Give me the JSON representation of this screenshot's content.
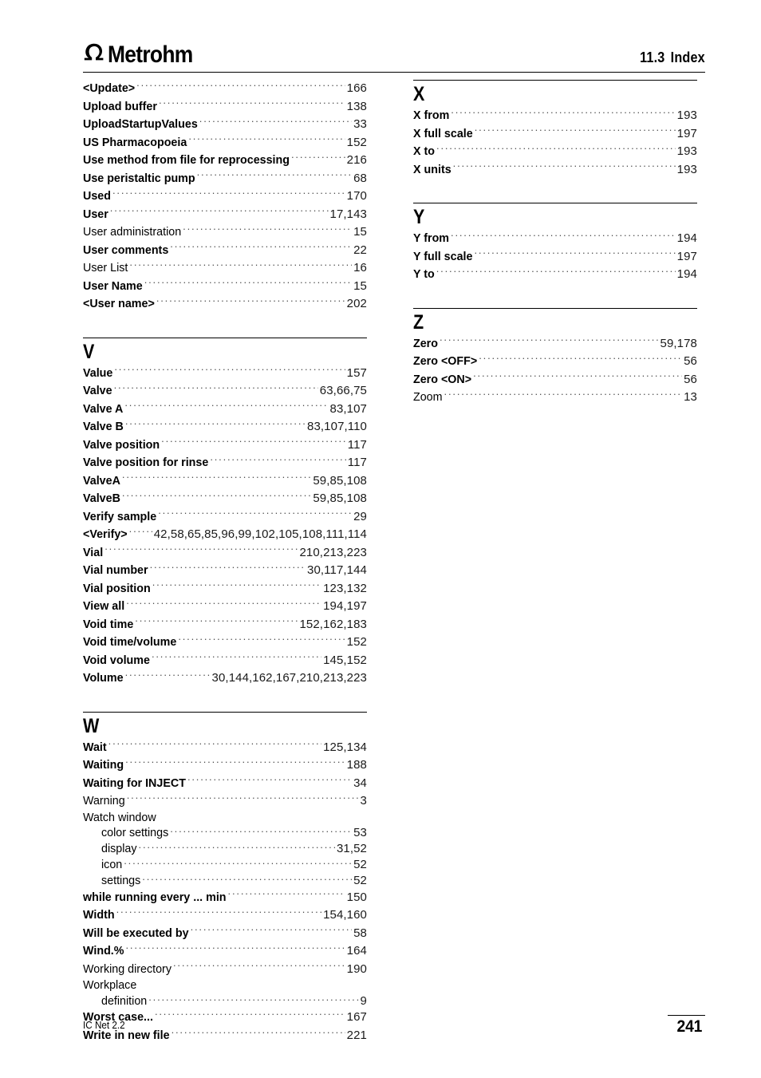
{
  "header": {
    "logo_text": "Metrohm",
    "logo_mark": "omega-icon",
    "section_number": "11.3",
    "section_title": "Index"
  },
  "footer": {
    "product": "IC Net 2.2",
    "page_number": "241"
  },
  "columns": {
    "left": [
      {
        "id": "u-continued",
        "letter": null,
        "rule": false,
        "entries": [
          {
            "label": "<Update>",
            "pages": "166",
            "bold": true
          },
          {
            "label": "Upload buffer",
            "pages": "138",
            "bold": true
          },
          {
            "label": "UploadStartupValues",
            "pages": "33",
            "bold": true
          },
          {
            "label": "US Pharmacopoeia",
            "pages": "152",
            "bold": true
          },
          {
            "label": "Use method from file for reprocessing",
            "pages": "216",
            "bold": true
          },
          {
            "label": "Use peristaltic pump",
            "pages": "68",
            "bold": true
          },
          {
            "label": "Used",
            "pages": "170",
            "bold": true
          },
          {
            "label": "User",
            "pages": "17,143",
            "bold": true
          },
          {
            "label": "User administration",
            "pages": "15",
            "bold": false
          },
          {
            "label": "User comments",
            "pages": "22",
            "bold": true
          },
          {
            "label": "User List",
            "pages": "16",
            "bold": false
          },
          {
            "label": "User Name",
            "pages": "15",
            "bold": true
          },
          {
            "label": "<User name>",
            "pages": "202",
            "bold": true
          }
        ]
      },
      {
        "id": "v",
        "letter": "V",
        "rule": true,
        "entries": [
          {
            "label": "Value",
            "pages": "157",
            "bold": true
          },
          {
            "label": "Valve",
            "pages": "63,66,75",
            "bold": true
          },
          {
            "label": "Valve A",
            "pages": "83,107",
            "bold": true
          },
          {
            "label": "Valve B",
            "pages": "83,107,110",
            "bold": true
          },
          {
            "label": "Valve position",
            "pages": "117",
            "bold": true
          },
          {
            "label": "Valve position for rinse",
            "pages": "117",
            "bold": true
          },
          {
            "label": "ValveA",
            "pages": "59,85,108",
            "bold": true
          },
          {
            "label": "ValveB",
            "pages": "59,85,108",
            "bold": true
          },
          {
            "label": "Verify sample",
            "pages": "29",
            "bold": true
          },
          {
            "label": "<Verify>",
            "pages": "42,58,65,85,96,99,102,105,108,111,114",
            "bold": true
          },
          {
            "label": "Vial",
            "pages": "210,213,223",
            "bold": true
          },
          {
            "label": "Vial number",
            "pages": "30,117,144",
            "bold": true
          },
          {
            "label": "Vial position",
            "pages": "123,132",
            "bold": true
          },
          {
            "label": "View all",
            "pages": "194,197",
            "bold": true
          },
          {
            "label": "Void time",
            "pages": "152,162,183",
            "bold": true
          },
          {
            "label": "Void time/volume",
            "pages": "152",
            "bold": true
          },
          {
            "label": "Void volume",
            "pages": "145,152",
            "bold": true
          },
          {
            "label": "Volume",
            "pages": "30,144,162,167,210,213,223",
            "bold": true
          }
        ]
      },
      {
        "id": "w",
        "letter": "W",
        "rule": true,
        "entries": [
          {
            "label": "Wait",
            "pages": "125,134",
            "bold": true
          },
          {
            "label": "Waiting",
            "pages": "188",
            "bold": true
          },
          {
            "label": "Waiting for INJECT",
            "pages": "34",
            "bold": true
          },
          {
            "label": "Warning",
            "pages": "3",
            "bold": false
          },
          {
            "label": "Watch window",
            "pages": "",
            "bold": false,
            "group": true
          },
          {
            "label": "color settings",
            "pages": "53",
            "bold": false,
            "sub": true
          },
          {
            "label": "display",
            "pages": "31,52",
            "bold": false,
            "sub": true
          },
          {
            "label": "icon",
            "pages": "52",
            "bold": false,
            "sub": true
          },
          {
            "label": "settings",
            "pages": "52",
            "bold": false,
            "sub": true
          },
          {
            "label": "while running every ... min",
            "pages": "150",
            "bold": true
          },
          {
            "label": "Width",
            "pages": "154,160",
            "bold": true
          },
          {
            "label": "Will be executed by",
            "pages": "58",
            "bold": true
          },
          {
            "label": "Wind.%",
            "pages": "164",
            "bold": true
          },
          {
            "label": "Working directory",
            "pages": "190",
            "bold": false
          },
          {
            "label": "Workplace",
            "pages": "",
            "bold": false,
            "group": true
          },
          {
            "label": "definition",
            "pages": "9",
            "bold": false,
            "sub": true
          },
          {
            "label": "Worst case...",
            "pages": "167",
            "bold": true
          },
          {
            "label": "Write in new file",
            "pages": "221",
            "bold": true
          }
        ]
      }
    ],
    "right": [
      {
        "id": "x",
        "letter": "X",
        "rule": true,
        "entries": [
          {
            "label": "X from",
            "pages": "193",
            "bold": true
          },
          {
            "label": "X full scale",
            "pages": "197",
            "bold": true
          },
          {
            "label": "X to",
            "pages": "193",
            "bold": true
          },
          {
            "label": "X units",
            "pages": "193",
            "bold": true
          }
        ]
      },
      {
        "id": "y",
        "letter": "Y",
        "rule": true,
        "entries": [
          {
            "label": "Y from",
            "pages": "194",
            "bold": true
          },
          {
            "label": "Y full scale",
            "pages": "197",
            "bold": true
          },
          {
            "label": "Y to",
            "pages": "194",
            "bold": true
          }
        ]
      },
      {
        "id": "z",
        "letter": "Z",
        "rule": true,
        "entries": [
          {
            "label": "Zero",
            "pages": "59,178",
            "bold": true
          },
          {
            "label": "Zero <OFF>",
            "pages": "56",
            "bold": true
          },
          {
            "label": "Zero <ON>",
            "pages": "56",
            "bold": true
          },
          {
            "label": "Zoom",
            "pages": "13",
            "bold": false
          }
        ]
      }
    ]
  }
}
